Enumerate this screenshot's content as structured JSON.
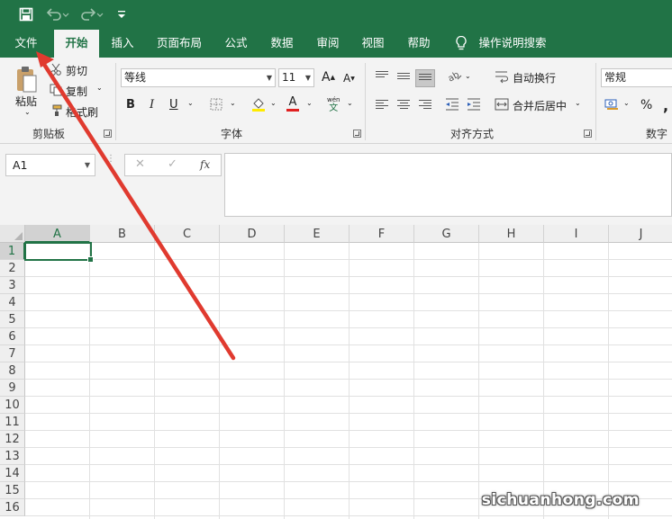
{
  "quick_access": {
    "save_icon": "save-icon",
    "undo_icon": "undo-icon",
    "redo_icon": "redo-icon",
    "customize_icon": "customize-qat-icon"
  },
  "tabs": [
    {
      "label": "文件"
    },
    {
      "label": "开始"
    },
    {
      "label": "插入"
    },
    {
      "label": "页面布局"
    },
    {
      "label": "公式"
    },
    {
      "label": "数据"
    },
    {
      "label": "审阅"
    },
    {
      "label": "视图"
    },
    {
      "label": "帮助"
    },
    {
      "label": "操作说明搜索"
    }
  ],
  "clipboard": {
    "paste": "粘贴",
    "cut": "剪切",
    "copy": "复制",
    "format_painter": "格式刷",
    "group": "剪贴板"
  },
  "font": {
    "name": "等线",
    "size": "11",
    "bold": "B",
    "italic": "I",
    "underline": "U",
    "group": "字体",
    "grow": "A",
    "shrink": "A",
    "color_letter": "A",
    "phonetic": "wén"
  },
  "alignment": {
    "wrap": "自动换行",
    "merge": "合并后居中",
    "group": "对齐方式"
  },
  "number": {
    "format": "常规",
    "percent": "%",
    "group": "数字"
  },
  "formula_bar": {
    "name_box": "A1",
    "cancel": "✕",
    "enter": "✓",
    "fx": "fx"
  },
  "columns": [
    "A",
    "B",
    "C",
    "D",
    "E",
    "F",
    "G",
    "H",
    "I",
    "J"
  ],
  "rows": [
    "1",
    "2",
    "3",
    "4",
    "5",
    "6",
    "7",
    "8",
    "9",
    "10",
    "11",
    "12",
    "13",
    "14",
    "15",
    "16"
  ],
  "watermark": "sichuanhong.com",
  "colors": {
    "accent": "#217346",
    "arrow": "#e03a2f"
  }
}
